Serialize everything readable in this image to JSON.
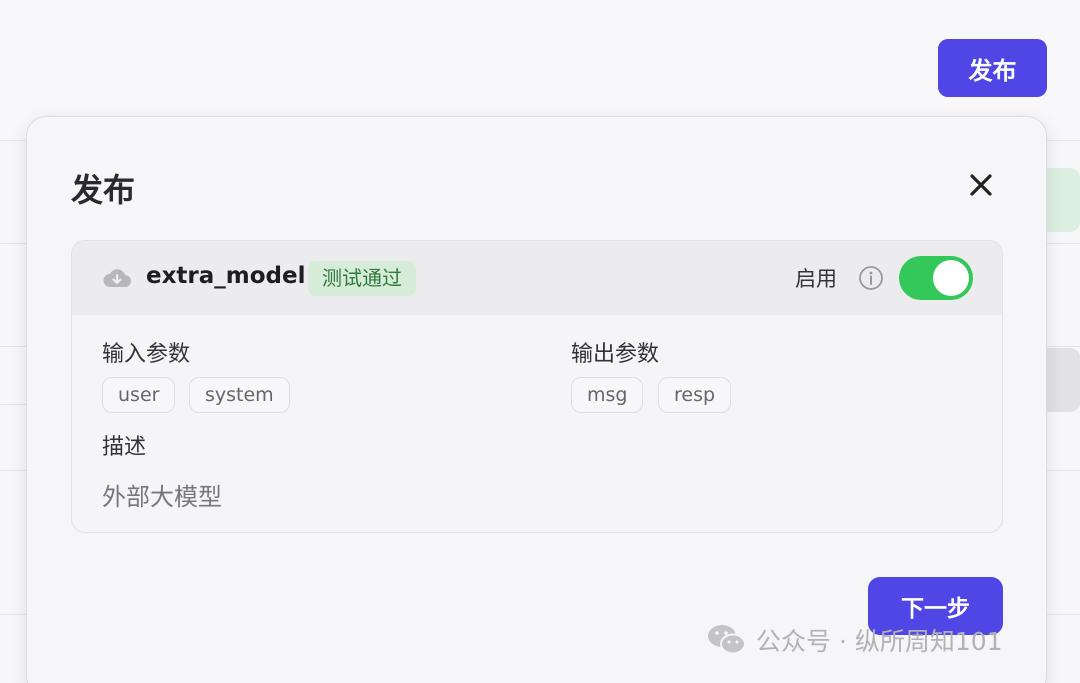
{
  "background": {
    "publish_label": "发布"
  },
  "modal": {
    "title": "发布",
    "close_icon": "close-icon",
    "card": {
      "model_name": "extra_model",
      "status": "测试通过",
      "enable_label": "启用",
      "enabled": true,
      "input_params_label": "输入参数",
      "input_params": [
        "user",
        "system"
      ],
      "output_params_label": "输出参数",
      "output_params": [
        "msg",
        "resp"
      ],
      "description_label": "描述",
      "description": "外部大模型"
    },
    "next_label": "下一步"
  },
  "watermark": {
    "text": "公众号 · 纵所周知101"
  },
  "colors": {
    "accent": "#4f46e5",
    "toggle_on": "#34c759",
    "badge_bg": "#d6ecd8",
    "badge_text": "#2f7a3d"
  }
}
